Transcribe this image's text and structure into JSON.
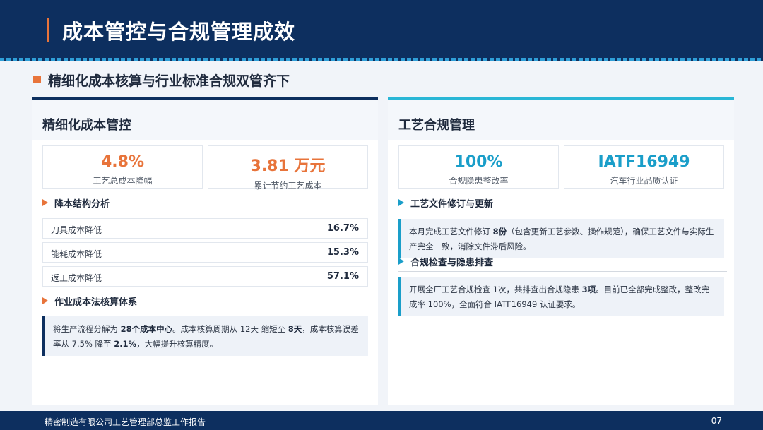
{
  "header": {
    "title": "成本管控与合规管理成效"
  },
  "section": {
    "heading": "精细化成本核算与行业标准合规双管齐下"
  },
  "left_card": {
    "title": "精细化成本管控",
    "stats": [
      {
        "value": "4.8%",
        "label": "工艺总成本降幅"
      },
      {
        "value": "3.81 万元",
        "label": "累计节约工艺成本"
      }
    ],
    "sub1": "降本结构分析",
    "rows": [
      {
        "label": "刀具成本降低",
        "value": "16.7%"
      },
      {
        "label": "能耗成本降低",
        "value": "15.3%"
      },
      {
        "label": "返工成本降低",
        "value": "57.1%"
      }
    ],
    "sub2": "作业成本法核算体系",
    "note": {
      "p1": "将生产流程分解为 ",
      "b1": "28个成本中心",
      "p2": "。成本核算周期从 12天 缩短至 ",
      "b2": "8天",
      "p3": "，成本核算误差率从 7.5% 降至 ",
      "b3": "2.1%",
      "p4": "，大幅提升核算精度。"
    }
  },
  "right_card": {
    "title": "工艺合规管理",
    "stats": [
      {
        "value": "100%",
        "label": "合规隐患整改率"
      },
      {
        "value": "IATF16949",
        "label": "汽车行业品质认证"
      }
    ],
    "sub1": "工艺文件修订与更新",
    "note1": {
      "p1": "本月完成工艺文件修订 ",
      "b1": "8份",
      "p2": "（包含更新工艺参数、操作规范），确保工艺文件与实际生产完全一致，消除文件滞后风险。"
    },
    "sub2": "合规检查与隐患排查",
    "note2": {
      "p1": "开展全厂工艺合规检查 1次，共排查出合规隐患 ",
      "b1": "3项",
      "p2": "。目前已全部完成整改，整改完成率 100%，全面符合 IATF16949 认证要求。"
    }
  },
  "footer": {
    "text": "精密制造有限公司工艺管理部总监工作报告",
    "page": "07"
  },
  "colors": {
    "navy": "#0d2f5f",
    "orange": "#e8743b",
    "cyan": "#29b6d6",
    "blue": "#1a9ec9"
  }
}
